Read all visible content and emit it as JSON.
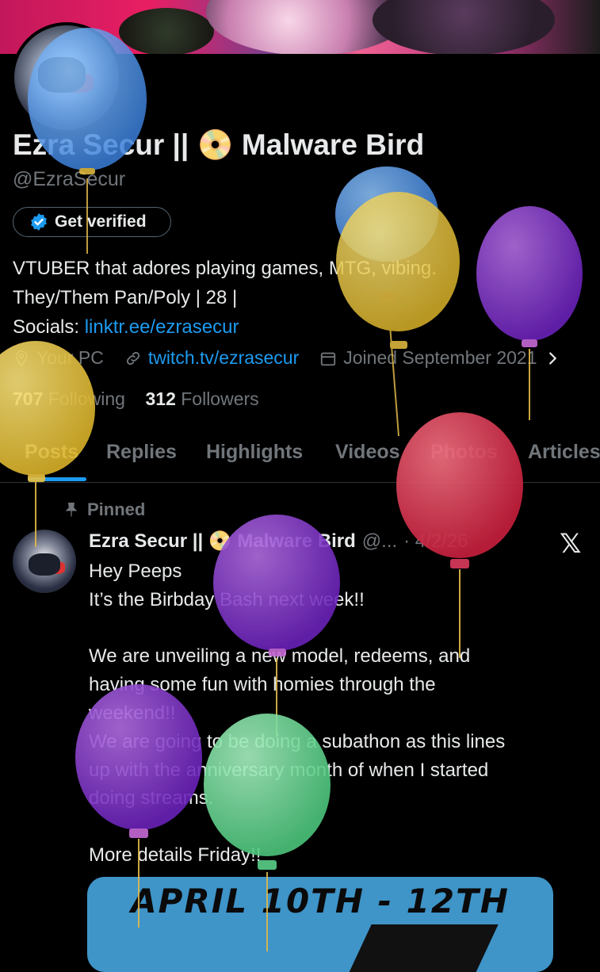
{
  "profile": {
    "display_name": "Ezra Secur || 📀 Malware Bird",
    "handle": "@EzraSecur",
    "verify_label": "Get verified",
    "bio_line1": "VTUBER that adores playing games, MTG, vibing.",
    "bio_line2": "They/Them Pan/Poly | 28 |",
    "bio_line3_prefix": "Socials: ",
    "bio_link": "linktr.ee/ezrasecur",
    "location": "Your PC",
    "website": "twitch.tv/ezrasecur",
    "joined": "Joined September 2021",
    "following_count": "707",
    "following_label": "Following",
    "followers_count": "312",
    "followers_label": "Followers"
  },
  "tabs": [
    "Posts",
    "Replies",
    "Highlights",
    "Videos",
    "Photos",
    "Articles"
  ],
  "pinned_post": {
    "pinned_label": "Pinned",
    "author_name": "Ezra Secur || 📀 Malware Bird",
    "author_handle": "@...",
    "date": "· 4/2/26",
    "lines": [
      "Hey Peeps",
      "It’s the Birbday Bash next week!!",
      "",
      "We are unveiling a new model, redeems, and",
      "having some fun with homies through the",
      "weekend!!",
      "We are going to be doing a subathon as this lines",
      "up with the anniversary month of when I started",
      "doing streams.",
      "",
      "More details Friday!!"
    ],
    "media_title": "APRIL 10TH - 12TH"
  },
  "colors": {
    "accent": "#1d9bf0",
    "muted": "#71767b",
    "text": "#e7e9ea",
    "background": "#000000"
  },
  "icons": [
    "verified-badge-icon",
    "location-icon",
    "link-icon",
    "calendar-icon",
    "chevron-right-icon",
    "pin-icon",
    "x-logo-icon"
  ]
}
